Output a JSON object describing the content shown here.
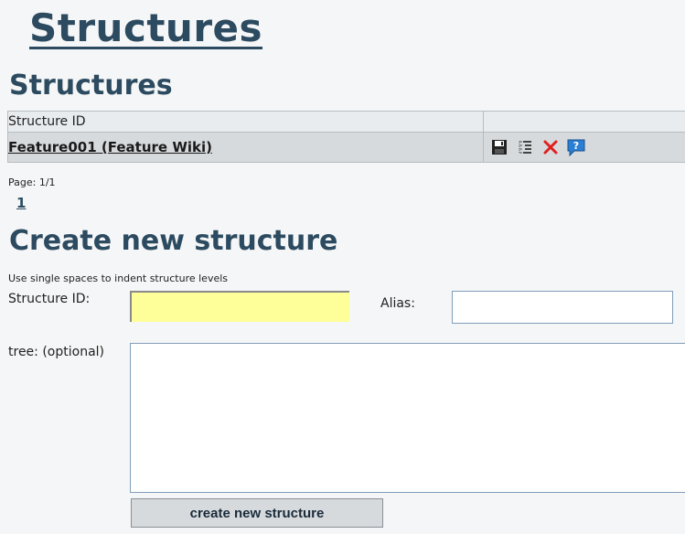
{
  "header": {
    "title": "Structures"
  },
  "structures_section": {
    "title": "Structures",
    "table": {
      "column_header": "Structure ID",
      "rows": [
        {
          "name": "Feature001 (Feature Wiki)",
          "actions": [
            "save-icon",
            "tree-view-icon",
            "delete-icon",
            "help-icon"
          ]
        }
      ]
    },
    "pagination": {
      "label": "Page: 1/1",
      "page_link": "1"
    }
  },
  "create_section": {
    "title": "Create new structure",
    "hint": "Use single spaces to indent structure levels",
    "structure_id_label": "Structure ID:",
    "structure_id_value": "",
    "alias_label": "Alias:",
    "alias_value": "",
    "tree_label": "tree: (optional)",
    "tree_value": "",
    "submit_label": "create new structure"
  },
  "colors": {
    "heading": "#2c4a60",
    "required_field_bg": "#ffff99",
    "row_bg": "#d7dadd",
    "delete_icon": "#e02020",
    "help_icon": "#2a7fd4"
  }
}
